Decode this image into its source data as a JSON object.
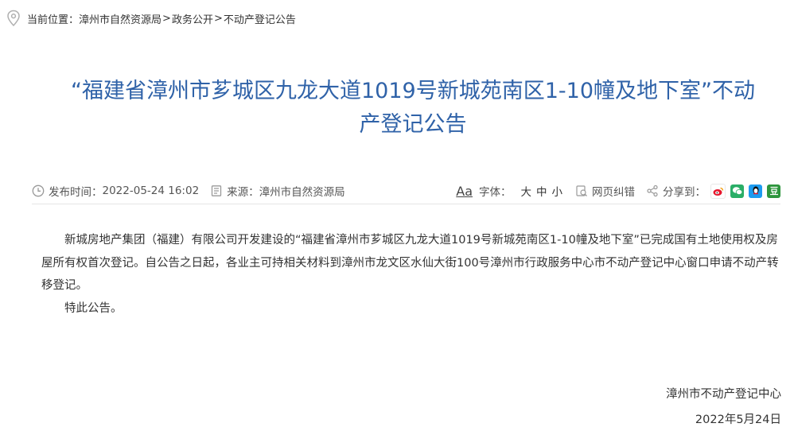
{
  "breadcrumb": {
    "label": "当前位置：",
    "items": [
      "漳州市自然资源局",
      "政务公开",
      "不动产登记公告"
    ],
    "separator": ">"
  },
  "article": {
    "title_line1": "“福建省漳州市芗城区九龙大道1019号新城苑南区1-10幢及地下室”不动",
    "title_line2": "产登记公告",
    "paragraph1": "新城房地产集团（福建）有限公司开发建设的“福建省漳州市芗城区九龙大道1019号新城苑南区1-10幢及地下室”已完成国有土地使用权及房屋所有权首次登记。自公告之日起，各业主可持相关材料到漳州市龙文区水仙大街100号漳州市行政服务中心市不动产登记中心窗口申请不动产转移登记。",
    "paragraph2": "特此公告。",
    "signature_org": "漳州市不动产登记中心",
    "signature_date": "2022年5月24日"
  },
  "meta": {
    "publish_label": "发布时间：",
    "publish_time": "2022-05-24 16:02",
    "source_label": "来源：",
    "source_value": "漳州市自然资源局",
    "font_icon_text": "Aa",
    "font_label": "字体：",
    "font_large": "大",
    "font_medium": "中",
    "font_small": "小",
    "correction_label": "网页纠错",
    "share_label": "分享到："
  },
  "colors": {
    "title": "#2f62a8",
    "weibo": "#e6162d",
    "wechat": "#2aae67",
    "qq": "#1d9bf0",
    "douban": "#2e963d"
  },
  "icons": [
    "location-pin-icon",
    "clock-icon",
    "source-icon",
    "font-size-icon",
    "error-report-icon",
    "share-icon",
    "weibo-icon",
    "wechat-icon",
    "qq-icon",
    "douban-icon"
  ]
}
